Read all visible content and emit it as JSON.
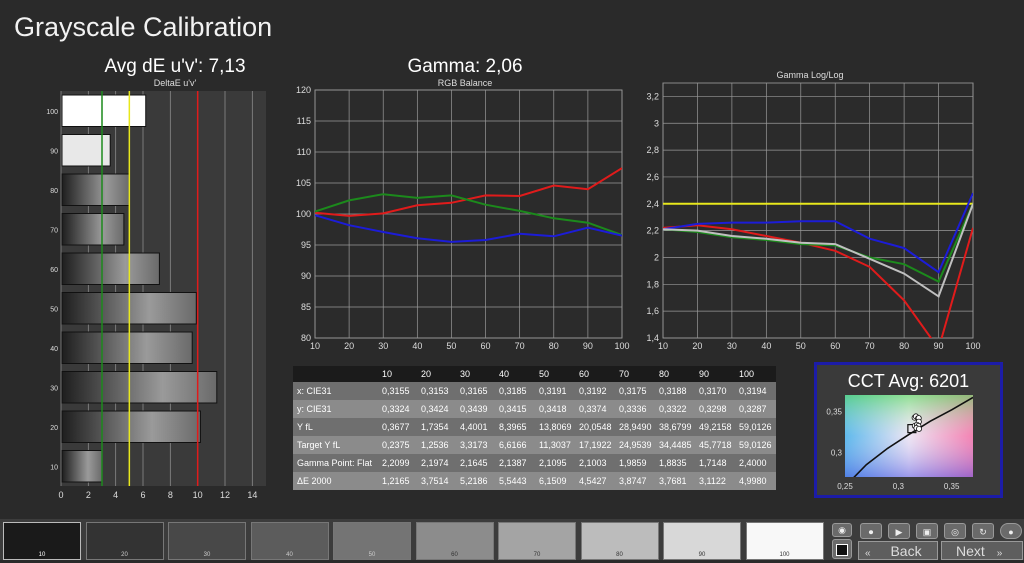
{
  "page": {
    "title": "Grayscale Calibration"
  },
  "titles": {
    "deltae_main": "Avg dE u'v': 7,13",
    "deltae_sub": "DeltaE u'v'",
    "gamma_main": "Gamma: 2,06",
    "rgb_sub": "RGB Balance",
    "loglog_sub": "Gamma Log/Log",
    "cct": "CCT Avg: 6201"
  },
  "colors": {
    "red": "#e01b1b",
    "green": "#1c8a1c",
    "blue": "#1c1cd8",
    "yellow": "#e8e81c",
    "gray": "#c0c0c0",
    "panel": "#2e2e2e",
    "cct_border": "#1c1ca8"
  },
  "chart_data": [
    {
      "type": "bar",
      "orientation": "horizontal",
      "title": "DeltaE u'v'",
      "categories": [
        "100",
        "90",
        "80",
        "70",
        "60",
        "50",
        "40",
        "30",
        "20",
        "10"
      ],
      "values": [
        6.2,
        3.6,
        5.0,
        4.6,
        7.2,
        9.9,
        9.6,
        11.4,
        10.2,
        3.0
      ],
      "xlim": [
        0,
        15
      ],
      "xticks": [
        "0",
        "2",
        "4",
        "6",
        "8",
        "10",
        "12",
        "14"
      ],
      "reference_lines": [
        {
          "x": 3,
          "color": "#1c8a1c"
        },
        {
          "x": 5,
          "color": "#e8e81c"
        },
        {
          "x": 10,
          "color": "#e01b1b"
        }
      ]
    },
    {
      "type": "line",
      "title": "RGB Balance",
      "x": [
        10,
        20,
        30,
        40,
        50,
        60,
        70,
        80,
        90,
        100
      ],
      "xticks": [
        "10",
        "20",
        "30",
        "40",
        "50",
        "60",
        "70",
        "80",
        "90",
        "100"
      ],
      "yticks": [
        "80",
        "85",
        "90",
        "95",
        "100",
        "105",
        "110",
        "115",
        "120"
      ],
      "ylim": [
        80,
        120
      ],
      "series": [
        {
          "color": "#e01b1b",
          "values": [
            100.2,
            99.7,
            100.1,
            101.4,
            101.8,
            103.0,
            102.9,
            104.6,
            104.0,
            107.4
          ]
        },
        {
          "color": "#1c8a1c",
          "values": [
            100.4,
            102.2,
            103.2,
            102.6,
            103.0,
            101.5,
            100.5,
            99.3,
            98.6,
            96.6
          ]
        },
        {
          "color": "#1c1cd8",
          "values": [
            99.8,
            98.2,
            97.1,
            96.1,
            95.5,
            95.8,
            96.8,
            96.4,
            97.8,
            96.5
          ]
        }
      ]
    },
    {
      "type": "line",
      "title": "Gamma Log/Log",
      "x": [
        10,
        20,
        30,
        40,
        50,
        60,
        70,
        80,
        90,
        100
      ],
      "xticks": [
        "10",
        "20",
        "30",
        "40",
        "50",
        "60",
        "70",
        "80",
        "90",
        "100"
      ],
      "yticks": [
        "1,4",
        "1,6",
        "1,8",
        "2",
        "2,2",
        "2,4",
        "2,6",
        "2,8",
        "3",
        "3,2"
      ],
      "ylim": [
        1.4,
        3.3
      ],
      "target": {
        "value": 2.4,
        "color": "#e8e81c"
      },
      "series": [
        {
          "color": "#e01b1b",
          "values": [
            2.22,
            2.24,
            2.21,
            2.16,
            2.11,
            2.05,
            1.93,
            1.68,
            1.32,
            2.22
          ]
        },
        {
          "color": "#1c8a1c",
          "values": [
            2.21,
            2.19,
            2.15,
            2.13,
            2.1,
            2.09,
            2.0,
            1.95,
            1.82,
            2.4
          ]
        },
        {
          "color": "#1c1cd8",
          "values": [
            2.21,
            2.25,
            2.26,
            2.26,
            2.27,
            2.27,
            2.14,
            2.07,
            1.89,
            2.48
          ]
        },
        {
          "color": "#c0c0c0",
          "values": [
            2.21,
            2.2,
            2.16,
            2.14,
            2.11,
            2.1,
            1.99,
            1.88,
            1.71,
            2.4
          ]
        }
      ]
    },
    {
      "type": "table",
      "columns": [
        "",
        "10",
        "20",
        "30",
        "40",
        "50",
        "60",
        "70",
        "80",
        "90",
        "100"
      ],
      "rows": [
        [
          "x: CIE31",
          "0,3155",
          "0,3153",
          "0,3165",
          "0,3185",
          "0,3191",
          "0,3192",
          "0,3175",
          "0,3188",
          "0,3170",
          "0,3194"
        ],
        [
          "y: CIE31",
          "0,3324",
          "0,3424",
          "0,3439",
          "0,3415",
          "0,3418",
          "0,3374",
          "0,3336",
          "0,3322",
          "0,3298",
          "0,3287"
        ],
        [
          "Y fL",
          "0,3677",
          "1,7354",
          "4,4001",
          "8,3965",
          "13,8069",
          "20,0548",
          "28,9490",
          "38,6799",
          "49,2158",
          "59,0126"
        ],
        [
          "Target Y fL",
          "0,2375",
          "1,2536",
          "3,3173",
          "6,6166",
          "11,3037",
          "17,1922",
          "24,9539",
          "34,4485",
          "45,7718",
          "59,0126"
        ],
        [
          "Gamma Point: Flat",
          "2,2099",
          "2,1974",
          "2,1645",
          "2,1387",
          "2,1095",
          "2,1003",
          "1,9859",
          "1,8835",
          "1,7148",
          "2,4000"
        ],
        [
          "ΔE 2000",
          "1,2165",
          "3,7514",
          "5,2186",
          "5,5443",
          "6,1509",
          "4,5427",
          "3,8747",
          "3,7681",
          "3,1122",
          "4,9980"
        ]
      ]
    },
    {
      "type": "scatter",
      "title": "CCT Avg: 6201",
      "xlim": [
        0.25,
        0.37
      ],
      "ylim": [
        0.27,
        0.37
      ],
      "xticks": [
        "0,25",
        "0,3",
        "0,35"
      ],
      "yticks": [
        "0,3",
        "0,35"
      ],
      "points": [
        {
          "x": 0.3155,
          "y": 0.3324
        },
        {
          "x": 0.3153,
          "y": 0.3424
        },
        {
          "x": 0.3165,
          "y": 0.3439
        },
        {
          "x": 0.3185,
          "y": 0.3415
        },
        {
          "x": 0.3191,
          "y": 0.3418
        },
        {
          "x": 0.3192,
          "y": 0.3374
        },
        {
          "x": 0.3175,
          "y": 0.3336
        },
        {
          "x": 0.3188,
          "y": 0.3322
        },
        {
          "x": 0.317,
          "y": 0.3298
        },
        {
          "x": 0.3194,
          "y": 0.3287
        }
      ],
      "target": {
        "x": 0.3127,
        "y": 0.329
      }
    }
  ],
  "patches": [
    {
      "label": "10",
      "color": "#1a1a1a"
    },
    {
      "label": "20",
      "color": "#333333"
    },
    {
      "label": "30",
      "color": "#484848"
    },
    {
      "label": "40",
      "color": "#5c5c5c"
    },
    {
      "label": "50",
      "color": "#747474"
    },
    {
      "label": "60",
      "color": "#8c8c8c"
    },
    {
      "label": "70",
      "color": "#a4a4a4"
    },
    {
      "label": "80",
      "color": "#bcbcbc"
    },
    {
      "label": "90",
      "color": "#d8d8d8"
    },
    {
      "label": "100",
      "color": "#f8f8f8"
    }
  ],
  "nav": {
    "back": "Back",
    "next": "Next"
  },
  "toolbar": {
    "stop_icon": "stop-icon",
    "settings_icon": "gear-icon",
    "play_icon": "play-icon",
    "save_icon": "save-icon",
    "view_icon": "eye-icon",
    "refresh_icon": "refresh-icon"
  }
}
